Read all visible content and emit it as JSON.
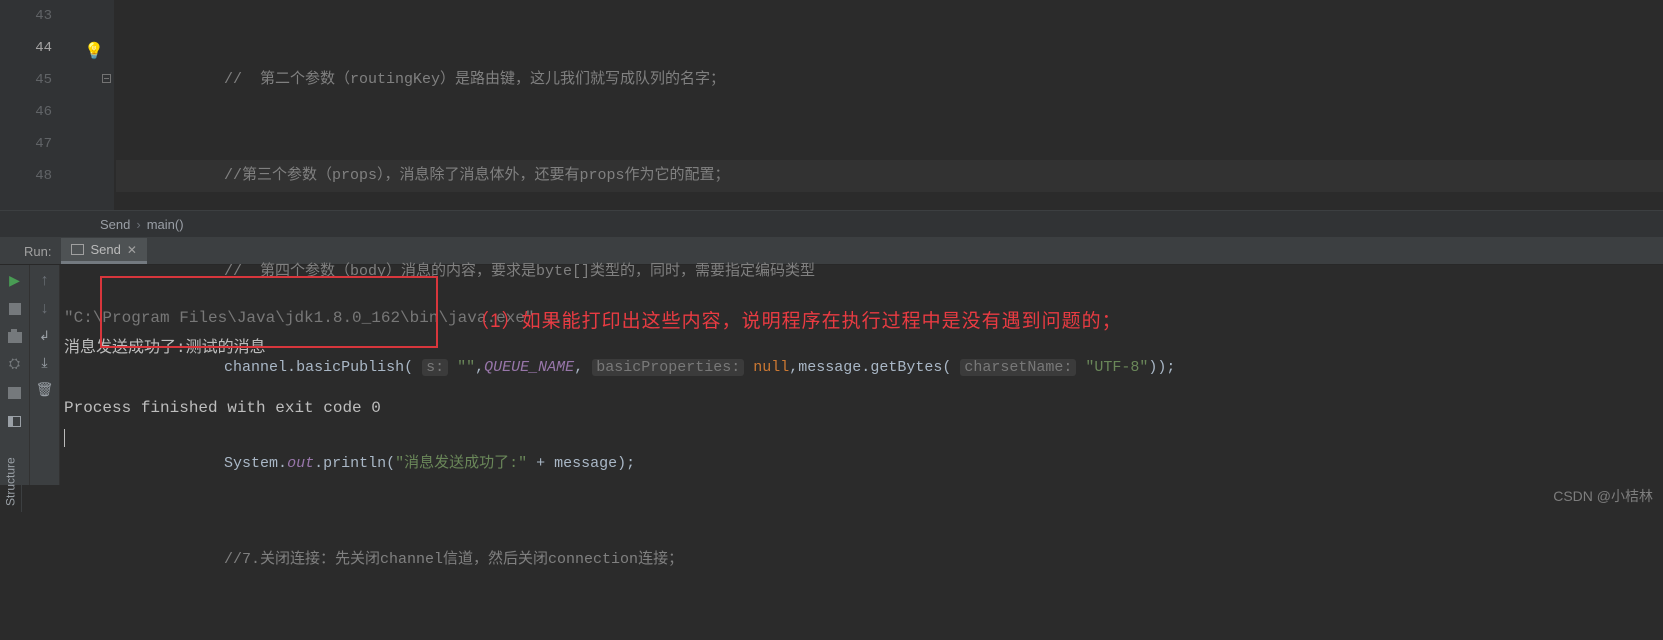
{
  "gutter": {
    "lines": [
      "43",
      "44",
      "45",
      "46",
      "47",
      "48"
    ],
    "current": "44"
  },
  "code": {
    "l43": "//  第二个参数（routingKey）是路由键，这儿我们就写成队列的名字；",
    "l44": "//第三个参数（props），消息除了消息体外，还要有props作为它的配置；",
    "l45": "//  第四个参数（body）消息的内容，要求是byte[]类型的，同时，需要指定编码类型",
    "l46": {
      "obj": "channel",
      "method": "basicPublish",
      "hint1": "s:",
      "arg1": "\"\"",
      "arg2": "QUEUE_NAME",
      "hint2": "basicProperties:",
      "arg3": "null",
      "arg4a": "message",
      "arg4b": "getBytes",
      "hint3": "charsetName:",
      "arg5": "\"UTF-8\""
    },
    "l47": {
      "cls": "System",
      "field": "out",
      "method": "println",
      "str": "\"消息发送成功了:\"",
      "plus": " + ",
      "var": "message"
    },
    "l48": "//7.关闭连接：先关闭channel信道，然后关闭connection连接；"
  },
  "breadcrumb": {
    "a": "Send",
    "b": "main()"
  },
  "run": {
    "label": "Run:",
    "tab": "Send",
    "line1": "\"C:\\Program Files\\Java\\jdk1.8.0_162\\bin\\java.exe\" ...",
    "line2": "消息发送成功了:测试的消息",
    "line3": "Process finished with exit code 0"
  },
  "annotation": "（1）如果能打印出这些内容，说明程序在执行过程中是没有遇到问题的；",
  "structure_label": "Structure",
  "watermark": "CSDN @小桔林"
}
